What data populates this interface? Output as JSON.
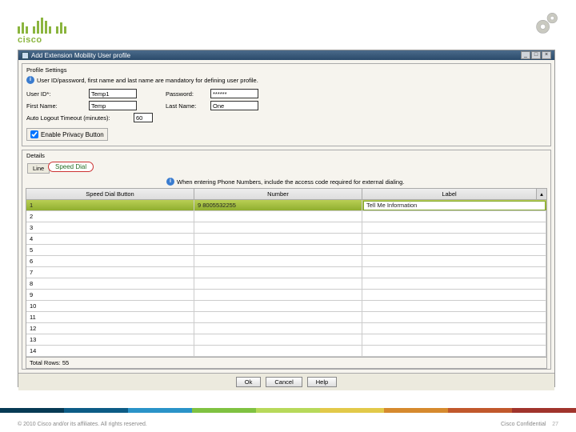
{
  "logo_text": "cisco",
  "window": {
    "title": "Add Extension Mobility User profile",
    "min": "_",
    "max": "□",
    "close": "×"
  },
  "profile": {
    "section_title": "Profile Settings",
    "hint": "User ID/password, first name and last name are mandatory for defining user profile.",
    "labels": {
      "user_id": "User ID*:",
      "password": "Password:",
      "first_name": "First Name:",
      "last_name": "Last Name:",
      "autologout": "Auto Logout Timeout (minutes):"
    },
    "values": {
      "user_id": "Temp1",
      "password": "******",
      "first_name": "Temp",
      "last_name": "One",
      "autologout": "60"
    },
    "privacy_label": "Enable Privacy Button"
  },
  "details": {
    "section_title": "Details",
    "tab_inactive": "Line",
    "tab_active": "Speed Dial",
    "hint": "When entering Phone Numbers, include the access code required for external dialing.",
    "columns": {
      "button": "Speed Dial Button",
      "number": "Number",
      "label": "Label"
    },
    "rows": [
      {
        "idx": "1",
        "number": "9 8005532255",
        "label": "Tell Me Information",
        "selected": true
      },
      {
        "idx": "2"
      },
      {
        "idx": "3"
      },
      {
        "idx": "4"
      },
      {
        "idx": "5"
      },
      {
        "idx": "6"
      },
      {
        "idx": "7"
      },
      {
        "idx": "8"
      },
      {
        "idx": "9"
      },
      {
        "idx": "10"
      },
      {
        "idx": "11"
      },
      {
        "idx": "12"
      },
      {
        "idx": "13"
      },
      {
        "idx": "14"
      }
    ],
    "total": "Total Rows: 55"
  },
  "buttons": {
    "ok": "Ok",
    "cancel": "Cancel",
    "help": "Help"
  },
  "footer": {
    "copyright": "© 2010 Cisco and/or its affiliates. All rights reserved.",
    "confidential": "Cisco Confidential",
    "page": "27"
  }
}
